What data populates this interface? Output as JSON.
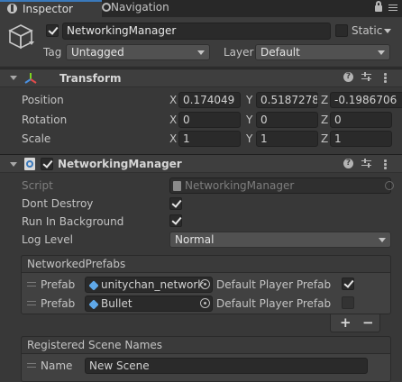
{
  "tabs": [
    {
      "label": "Inspector",
      "active": true
    },
    {
      "label": "Navigation",
      "active": false
    }
  ],
  "gameobject": {
    "name": "NetworkingManager",
    "static_label": "Static",
    "tag_label": "Tag",
    "tag_value": "Untagged",
    "layer_label": "Layer",
    "layer_value": "Default"
  },
  "transform": {
    "title": "Transform",
    "position_label": "Position",
    "rotation_label": "Rotation",
    "scale_label": "Scale",
    "axis_x": "X",
    "axis_y": "Y",
    "axis_z": "Z",
    "position": [
      "0.174049",
      "0.5187278",
      "-0.1986706"
    ],
    "rotation": [
      "0",
      "0",
      "0"
    ],
    "scale": [
      "1",
      "1",
      "1"
    ]
  },
  "networking_manager": {
    "title": "NetworkingManager",
    "script_label": "Script",
    "script_value": "NetworkingManager",
    "dont_destroy_label": "Dont Destroy",
    "run_in_background_label": "Run In Background",
    "log_level_label": "Log Level",
    "log_level_value": "Normal",
    "networked_prefabs": {
      "title": "NetworkedPrefabs",
      "prefab_label": "Prefab",
      "default_player_label": "Default Player Prefab",
      "items": [
        {
          "prefab": "unitychan_network",
          "default_player": true
        },
        {
          "prefab": "Bullet",
          "default_player": false
        }
      ],
      "add_label": "+",
      "remove_label": "−"
    },
    "scene_names": {
      "title": "Registered Scene Names",
      "name_label": "Name",
      "name_value": "New Scene"
    }
  },
  "colors": {
    "background": "#383838",
    "tab_bar": "#282828",
    "field": "#2a2a2a",
    "transform_icon_red": "#e24b4b",
    "transform_icon_green": "#7ed321",
    "transform_icon_blue": "#4a90e2",
    "prefab_icon_blue": "#5fa8e8"
  }
}
